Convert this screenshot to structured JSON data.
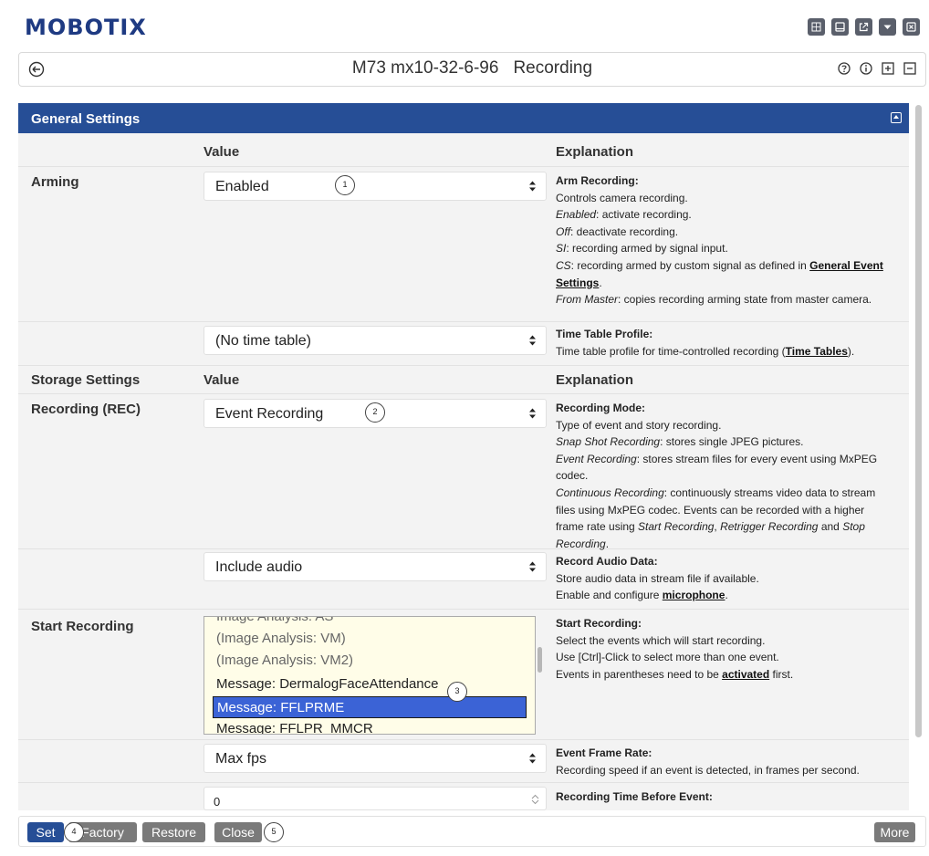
{
  "app": {
    "logo": "MOBOTIX"
  },
  "header_icons": [
    "grid-icon",
    "window-icon",
    "external-link-icon",
    "dropdown-icon",
    "close-box-icon"
  ],
  "page": {
    "device": "M73 mx10-32-6-96",
    "section": "Recording",
    "title_icons": [
      "help-icon",
      "info-icon",
      "expand-all-icon",
      "collapse-all-icon"
    ]
  },
  "panel": {
    "title": "General Settings",
    "col_value": "Value",
    "col_explanation": "Explanation",
    "arming": {
      "label": "Arming",
      "value": "Enabled",
      "marker": "1",
      "expl_title": "Arm Recording",
      "expl_1": "Controls camera recording.",
      "expl_2_term": "Enabled",
      "expl_2": ": activate recording.",
      "expl_3_term": "Off",
      "expl_3": ": deactivate recording.",
      "expl_4_term": "SI",
      "expl_4": ": recording armed by signal input.",
      "expl_5_term": "CS",
      "expl_5": ": recording armed by custom signal as defined in ",
      "expl_5_link_a": "General Event",
      "expl_5_link_b": "Settings",
      "expl_6_term": "From Master",
      "expl_6": ": copies recording arming state from master camera."
    },
    "timetable": {
      "value": "(No time table)",
      "expl_title": "Time Table Profile",
      "expl_1": "Time table profile for time-controlled recording (",
      "expl_link": "Time Tables",
      "expl_end": ")."
    },
    "storage": {
      "label": "Storage Settings",
      "col_value": "Value",
      "col_explanation": "Explanation"
    },
    "recording": {
      "label": "Recording (REC)",
      "value": "Event Recording",
      "marker": "2",
      "expl_title": "Recording Mode",
      "expl_1": "Type of event and story recording.",
      "expl_2_term": "Snap Shot Recording",
      "expl_2": ": stores single JPEG pictures.",
      "expl_3_term": "Event Recording",
      "expl_3": ": stores stream files for every event using MxPEG codec.",
      "expl_4_term": "Continuous Recording",
      "expl_4": ": continuously streams video data to stream files using MxPEG codec. Events can be recorded with a higher frame rate using ",
      "expl_4_t1": "Start Recording",
      "expl_4_sep": ", ",
      "expl_4_t2": "Retrigger Recording",
      "expl_4_and": " and ",
      "expl_4_t3": "Stop Recording",
      "expl_4_end": "."
    },
    "audio": {
      "value": "Include audio",
      "expl_title": "Record Audio Data",
      "expl_1": "Store audio data in stream file if available.",
      "expl_2": "Enable and configure ",
      "expl_link": "microphone",
      "expl_end": "."
    },
    "start_recording": {
      "label": "Start Recording",
      "marker": "3",
      "options": [
        {
          "text": "Image Analysis: AS",
          "dim": true,
          "selected": false
        },
        {
          "text": "(Image Analysis: VM)",
          "dim": true,
          "selected": false
        },
        {
          "text": "(Image Analysis: VM2)",
          "dim": true,
          "selected": false
        },
        {
          "text": "Message: DermalogFaceAttendance",
          "dim": false,
          "selected": false
        },
        {
          "text": "Message: FFLPRME",
          "dim": false,
          "selected": true
        },
        {
          "text": "Message: FFLPR_MMCR",
          "dim": false,
          "selected": false
        }
      ],
      "expl_title": "Start Recording",
      "expl_1": "Select the events which will start recording.",
      "expl_2": "Use [Ctrl]-Click to select more than one event.",
      "expl_3": "Events in parentheses need to be ",
      "expl_link": "activated",
      "expl_end": " first."
    },
    "frame_rate": {
      "value": "Max fps",
      "expl_title": "Event Frame Rate",
      "expl_1": "Recording speed if an event is detected, in frames per second."
    },
    "time_before": {
      "value": "0",
      "expl_title": "Recording Time Before Event"
    }
  },
  "buttons": {
    "set": "Set",
    "factory": "Factory",
    "restore": "Restore",
    "close": "Close",
    "more": "More",
    "marker_set": "4",
    "marker_close": "5"
  },
  "colors": {
    "accent": "#264e96",
    "selected": "#3b63d6",
    "listbox_bg": "#fffde8"
  }
}
